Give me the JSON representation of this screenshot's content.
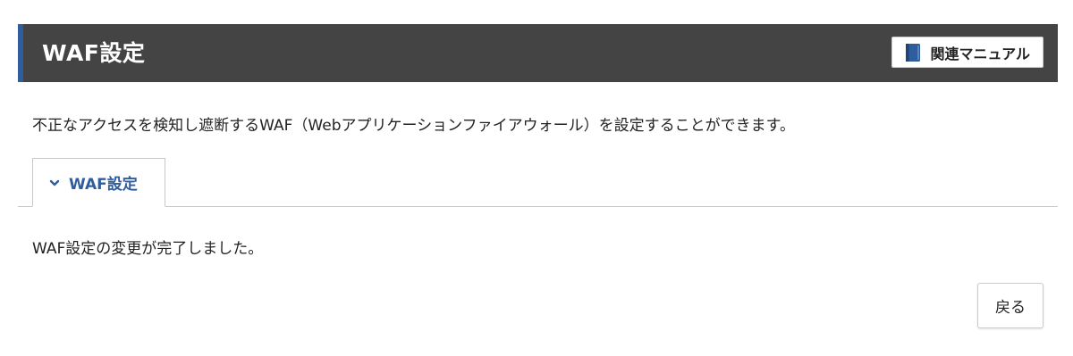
{
  "header": {
    "title": "WAF設定",
    "manual_button_label": "関連マニュアル",
    "manual_icon": "book-icon"
  },
  "description": "不正なアクセスを検知し遮断するWAF（Webアプリケーションファイアウォール）を設定することができます。",
  "tabs": [
    {
      "label": "WAF設定",
      "icon": "chevron-down-icon",
      "active": true
    }
  ],
  "message": "WAF設定の変更が完了しました。",
  "back_button_label": "戻る",
  "colors": {
    "header_bg": "#444444",
    "accent": "#2f5d9e",
    "tab_text": "#2f5d9e"
  }
}
